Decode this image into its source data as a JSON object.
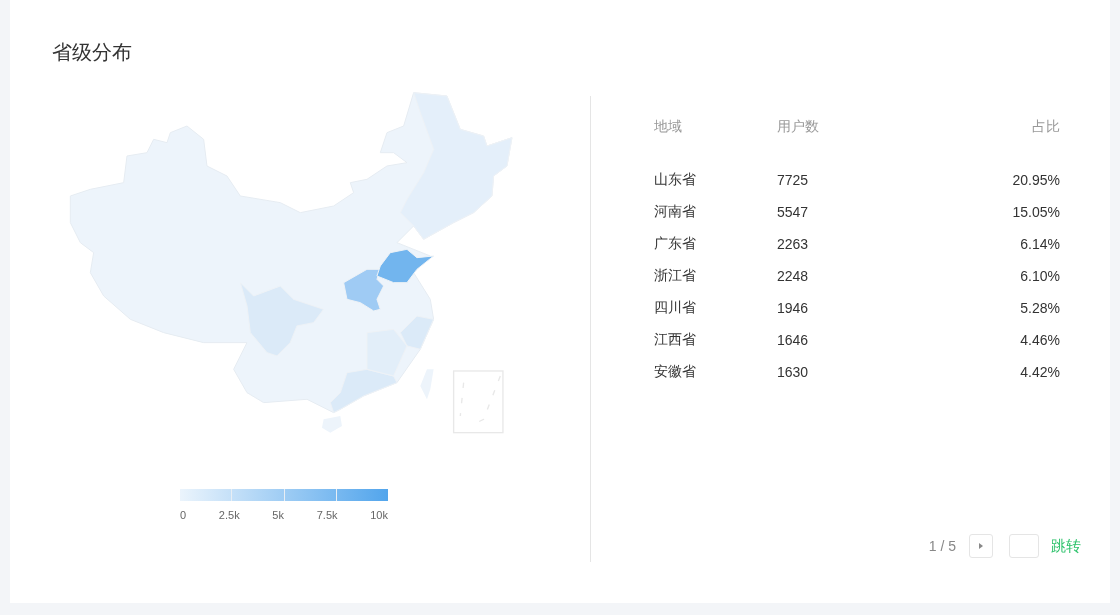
{
  "card": {
    "title": "省级分布"
  },
  "legend": {
    "labels": [
      "0",
      "2.5k",
      "5k",
      "7.5k",
      "10k"
    ]
  },
  "table": {
    "columns": [
      "地域",
      "用户数",
      "占比"
    ],
    "rows": [
      [
        "山东省",
        "7725",
        "20.95%"
      ],
      [
        "河南省",
        "5547",
        "15.05%"
      ],
      [
        "广东省",
        "2263",
        "6.14%"
      ],
      [
        "浙江省",
        "2248",
        "6.10%"
      ],
      [
        "四川省",
        "1946",
        "5.28%"
      ],
      [
        "江西省",
        "1646",
        "4.46%"
      ],
      [
        "安徽省",
        "1630",
        "4.42%"
      ]
    ]
  },
  "pagination": {
    "page": "1 / 5",
    "jump": "跳转"
  }
}
